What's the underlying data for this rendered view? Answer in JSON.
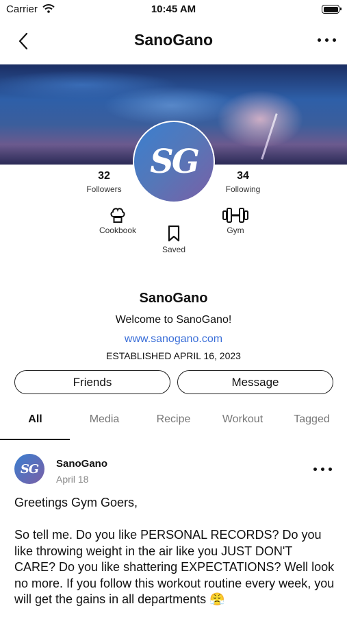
{
  "status_bar": {
    "carrier": "Carrier",
    "time": "10:45 AM"
  },
  "nav": {
    "title": "SanoGano"
  },
  "profile": {
    "avatar_text": "SG",
    "name": "SanoGano",
    "bio": "Welcome to SanoGano!",
    "website": "www.sanogano.com",
    "established": "ESTABLISHED APRIL 16, 2023"
  },
  "stats": {
    "followers": {
      "count": "32",
      "label": "Followers"
    },
    "following": {
      "count": "34",
      "label": "Following"
    }
  },
  "shortcuts": {
    "cookbook": "Cookbook",
    "saved": "Saved",
    "gym": "Gym"
  },
  "actions": {
    "friends": "Friends",
    "message": "Message"
  },
  "tabs": [
    {
      "label": "All",
      "active": true
    },
    {
      "label": "Media",
      "active": false
    },
    {
      "label": "Recipe",
      "active": false
    },
    {
      "label": "Workout",
      "active": false
    },
    {
      "label": "Tagged",
      "active": false
    }
  ],
  "post": {
    "avatar_text": "SG",
    "author": "SanoGano",
    "date": "April 18",
    "body": "Greetings Gym Goers,\n\nSo tell me. Do you like PERSONAL RECORDS? Do you like throwing weight in the air like you JUST DON'T CARE? Do you like shattering EXPECTATIONS? Well look no more. If you follow this workout routine every week, you will get the gains in all departments 😤"
  },
  "colors": {
    "link": "#3b6fd8",
    "accent": "#111111"
  }
}
